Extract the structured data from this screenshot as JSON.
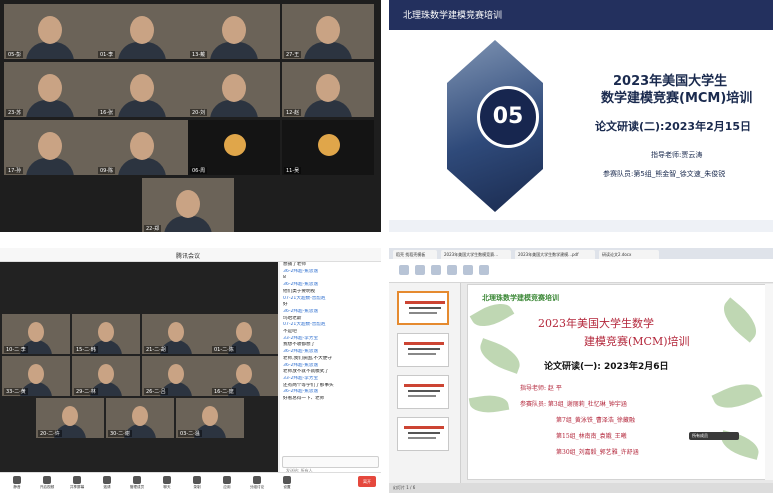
{
  "q1": {
    "tiles": [
      {
        "name": "05-彭",
        "dark": false
      },
      {
        "name": "01-李",
        "dark": false
      },
      {
        "name": "13-戴",
        "dark": false
      },
      {
        "name": "27-王",
        "dark": false
      },
      {
        "name": "23-苏",
        "dark": false
      },
      {
        "name": "16-张",
        "dark": false
      },
      {
        "name": "20-刘",
        "dark": false
      },
      {
        "name": "12-赵",
        "dark": false
      },
      {
        "name": "17-孙",
        "dark": false
      },
      {
        "name": "09-陈",
        "dark": false
      },
      {
        "name": "06-周",
        "dark": true
      },
      {
        "name": "11-吴",
        "dark": true
      },
      {
        "name": "22-郑",
        "dark": false
      }
    ]
  },
  "q2": {
    "org": "北理珠数学建模竞赛培训",
    "number": "05",
    "title_line1": "2023年美国大学生",
    "title_line2": "数学建模竞赛(MCM)培训",
    "subtitle": "论文研读(二):2023年2月15日",
    "instructor": "指导老师:贾云涛",
    "team": "参赛队员:第5组_熊金智_徐文速_朱俊锐"
  },
  "q3": {
    "title": "腾讯会议",
    "chat": [
      {
        "type": "msg",
        "text": "想捕了老师"
      },
      {
        "type": "name",
        "text": "36-2纬超-蕉思逸"
      },
      {
        "type": "msg",
        "text": "8"
      },
      {
        "type": "name",
        "text": "36-2纬超-蕉思逸"
      },
      {
        "type": "msg",
        "text": "他们类于要明视"
      },
      {
        "type": "name",
        "text": "07-21大超数-曾彪赳"
      },
      {
        "type": "msg",
        "text": "好"
      },
      {
        "type": "name",
        "text": "36-2纬超-蕉思逸"
      },
      {
        "type": "msg",
        "text": "玛哈老斯"
      },
      {
        "type": "name",
        "text": "07-21大超数-曾彪赳"
      },
      {
        "type": "msg",
        "text": "不是吧"
      },
      {
        "type": "name",
        "text": "33-2纬超-李芳宝"
      },
      {
        "type": "msg",
        "text": "我想不收都想了"
      },
      {
        "type": "name",
        "text": "36-2纬超-蕉思逸"
      },
      {
        "type": "msg",
        "text": "老师,我们获国,不大便守"
      },
      {
        "type": "name",
        "text": "36-2纬超-蕉思逸"
      },
      {
        "type": "msg",
        "text": "老师放不就不就模式了"
      },
      {
        "type": "name",
        "text": "33-2纬超-李芳宝"
      },
      {
        "type": "msg",
        "text": "还有两个等学们了那事头"
      },
      {
        "type": "name",
        "text": "36-2纬超-蕉思逸"
      },
      {
        "type": "msg",
        "text": "好看总得一下、老师"
      }
    ],
    "chat_hint": "发送给: 所有人",
    "tiles": [
      {
        "name": "10-二 李"
      },
      {
        "name": "15-二·韩"
      },
      {
        "name": "21-二·胡"
      },
      {
        "name": "01-二·陈"
      },
      {
        "name": "33-二·黄"
      },
      {
        "name": "29-二·林"
      },
      {
        "name": "26-二·吕"
      },
      {
        "name": "16-二·庞"
      },
      {
        "name": "20-二·许"
      },
      {
        "name": "30-二·谢"
      },
      {
        "name": "03-二·温"
      }
    ],
    "toolbar": [
      "静音",
      "开启视频",
      "共享屏幕",
      "邀请",
      "管理成员",
      "聊天",
      "录制",
      "应用",
      "分组讨论",
      "设置"
    ],
    "leave": "离开"
  },
  "q4": {
    "tabs": [
      "稻壳 找稻壳模板",
      "2023年美国大学生数模竞赛...",
      "2023年美国大学生数学建模...pdf",
      "研读论文2.docx"
    ],
    "org": "北理珠数学建模竞赛培训",
    "title_line1": "2023年美国大学生数学",
    "title_line2": "建模竞赛(MCM)培训",
    "subtitle": "论文研读(一): 2023年2月6日",
    "lines": [
      "指导老师: 赵 平",
      "参赛队员: 第3组_谢丽莉_杜忆琳_钟宇涵",
      "第7组_黄泳铁_曹泽浩_徐藏融",
      "第15组_林南南_袁娥_王曦",
      "第30组_刘嘉毅_郭艺雅_许舒涵"
    ],
    "chat": "所有成员",
    "status": "幻灯片 1 / 6"
  }
}
